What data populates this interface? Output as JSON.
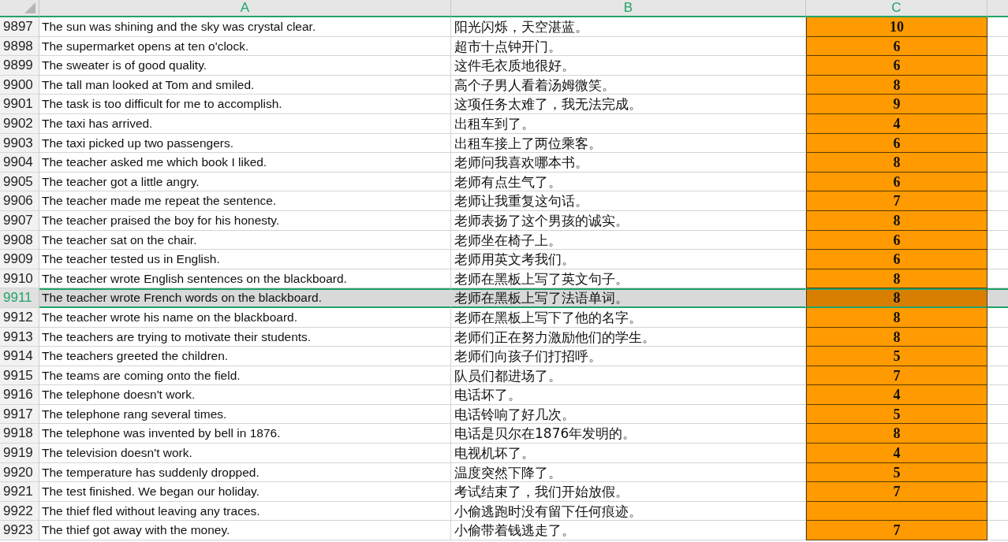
{
  "columns": [
    {
      "label": "A"
    },
    {
      "label": "B"
    },
    {
      "label": "C"
    }
  ],
  "rows": [
    {
      "number": "9897",
      "a": "The sun was shining and the sky was crystal clear.",
      "b": "阳光闪烁，天空湛蓝。",
      "c": "10",
      "selected": false
    },
    {
      "number": "9898",
      "a": "The supermarket opens at ten o'clock.",
      "b": "超市十点钟开门。",
      "c": "6",
      "selected": false
    },
    {
      "number": "9899",
      "a": "The sweater is of good quality.",
      "b": "这件毛衣质地很好。",
      "c": "6",
      "selected": false
    },
    {
      "number": "9900",
      "a": "The tall man looked at Tom and smiled.",
      "b": "高个子男人看着汤姆微笑。",
      "c": "8",
      "selected": false
    },
    {
      "number": "9901",
      "a": "The task is too difficult for me to accomplish.",
      "b": "这项任务太难了，我无法完成。",
      "c": "9",
      "selected": false
    },
    {
      "number": "9902",
      "a": "The taxi has arrived.",
      "b": "出租车到了。",
      "c": "4",
      "selected": false
    },
    {
      "number": "9903",
      "a": "The taxi picked up two passengers.",
      "b": "出租车接上了两位乘客。",
      "c": "6",
      "selected": false
    },
    {
      "number": "9904",
      "a": "The teacher asked me which book I liked.",
      "b": "老师问我喜欢哪本书。",
      "c": "8",
      "selected": false
    },
    {
      "number": "9905",
      "a": "The teacher got a little angry.",
      "b": "老师有点生气了。",
      "c": "6",
      "selected": false
    },
    {
      "number": "9906",
      "a": "The teacher made me repeat the sentence.",
      "b": "老师让我重复这句话。",
      "c": "7",
      "selected": false
    },
    {
      "number": "9907",
      "a": "The teacher praised the boy for his honesty.",
      "b": "老师表扬了这个男孩的诚实。",
      "c": "8",
      "selected": false
    },
    {
      "number": "9908",
      "a": "The teacher sat on the chair.",
      "b": "老师坐在椅子上。",
      "c": "6",
      "selected": false
    },
    {
      "number": "9909",
      "a": "The teacher tested us in English.",
      "b": "老师用英文考我们。",
      "c": "6",
      "selected": false
    },
    {
      "number": "9910",
      "a": "The teacher wrote English sentences on the blackboard.",
      "b": "老师在黑板上写了英文句子。",
      "c": "8",
      "selected": false
    },
    {
      "number": "9911",
      "a": "The teacher wrote French words on the blackboard.",
      "b": "老师在黑板上写了法语单词。",
      "c": "8",
      "selected": true
    },
    {
      "number": "9912",
      "a": "The teacher wrote his name on the blackboard.",
      "b": "老师在黑板上写下了他的名字。",
      "c": "8",
      "selected": false
    },
    {
      "number": "9913",
      "a": "The teachers are trying to motivate their students.",
      "b": "老师们正在努力激励他们的学生。",
      "c": "8",
      "selected": false
    },
    {
      "number": "9914",
      "a": "The teachers greeted the children.",
      "b": "老师们向孩子们打招呼。",
      "c": "5",
      "selected": false
    },
    {
      "number": "9915",
      "a": "The teams are coming onto the field.",
      "b": "队员们都进场了。",
      "c": "7",
      "selected": false
    },
    {
      "number": "9916",
      "a": "The telephone doesn't work.",
      "b": "电话坏了。",
      "c": "4",
      "selected": false
    },
    {
      "number": "9917",
      "a": "The telephone rang several times.",
      "b": "电话铃响了好几次。",
      "c": "5",
      "selected": false
    },
    {
      "number": "9918",
      "a": "The telephone was invented by bell in 1876.",
      "b": "电话是贝尔在1876年发明的。",
      "c": "8",
      "selected": false
    },
    {
      "number": "9919",
      "a": "The television doesn't work.",
      "b": "电视机坏了。",
      "c": "4",
      "selected": false
    },
    {
      "number": "9920",
      "a": "The temperature has suddenly dropped.",
      "b": "温度突然下降了。",
      "c": "5",
      "selected": false
    },
    {
      "number": "9921",
      "a": "The test finished. We began our holiday.",
      "b": "考试结束了，我们开始放假。",
      "c": "7",
      "selected": false
    },
    {
      "number": "9922",
      "a": "The thief fled without leaving any traces.",
      "b": "小偷逃跑时没有留下任何痕迹。",
      "selected": false
    },
    {
      "number": "9923",
      "a": "The thief got away with the money.",
      "b": "小偷带着钱逃走了。",
      "c": "7",
      "selected": false
    }
  ]
}
